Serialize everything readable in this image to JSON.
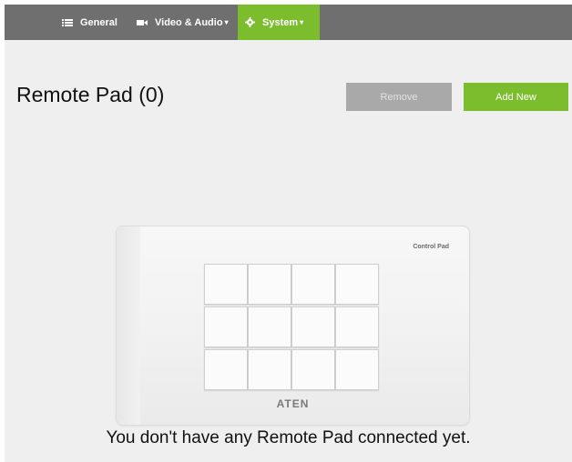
{
  "nav": {
    "items": [
      {
        "label": "General",
        "icon": "list-icon"
      },
      {
        "label": "Video & Audio",
        "icon": "video-icon",
        "dropdown": true
      },
      {
        "label": "System",
        "icon": "gear-icon",
        "dropdown": true,
        "active": true
      }
    ]
  },
  "page": {
    "title": "Remote Pad (0)"
  },
  "actions": {
    "remove_label": "Remove",
    "add_label": "Add New"
  },
  "pad": {
    "label": "Control Pad",
    "brand": "ATEN",
    "key_rows": 3,
    "key_cols": 4
  },
  "message": "You don't have any Remote Pad connected yet.",
  "colors": {
    "navbar": "#6f6f6f",
    "accent": "#7cbd2d",
    "disabled_button": "#a9a9a9",
    "background": "#efefef"
  }
}
